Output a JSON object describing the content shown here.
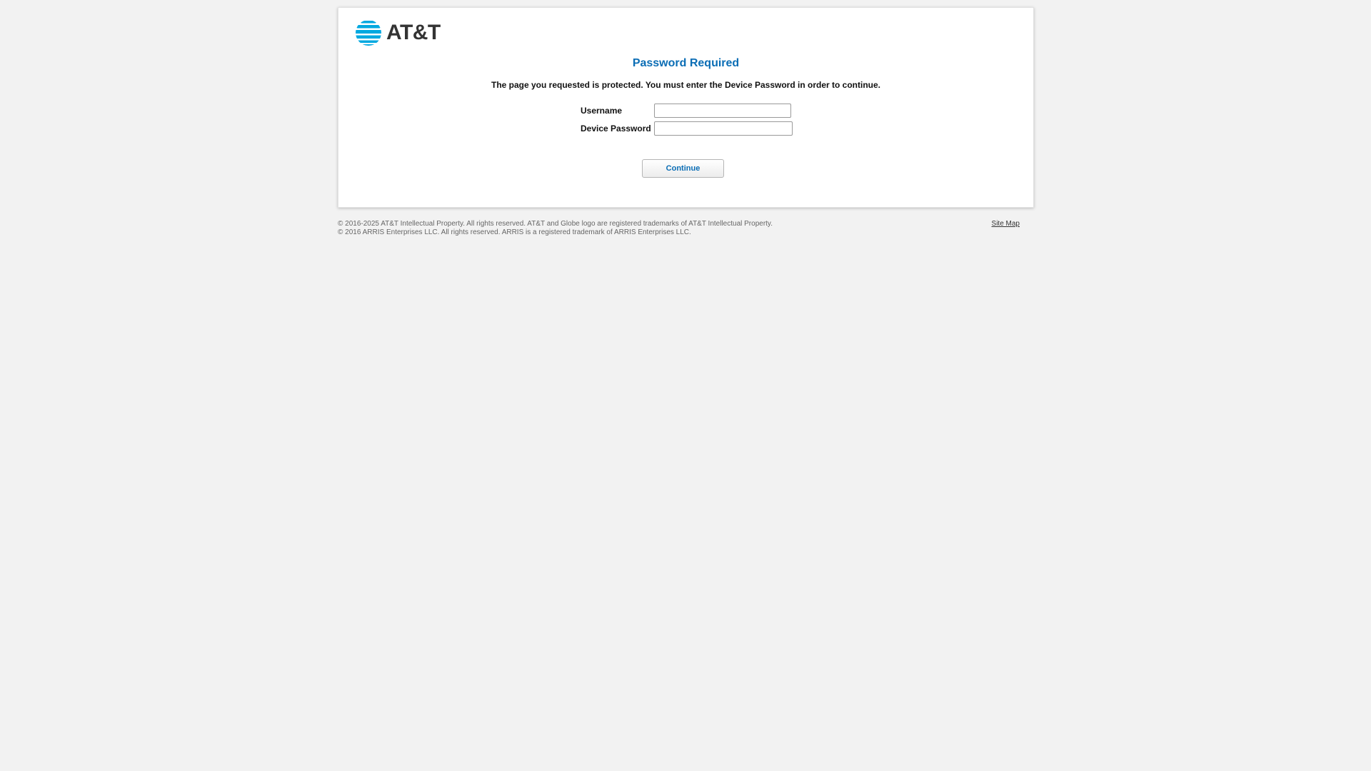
{
  "brand": {
    "logo_text": "AT&T",
    "accent_color": "#0a6db5",
    "globe_color": "#00a8e0",
    "logo_icon": "att-globe-icon"
  },
  "main": {
    "title": "Password Required",
    "description": "The page you requested is protected. You must enter the Device Password in order to continue."
  },
  "form": {
    "username_label": "Username",
    "username_value": "",
    "password_label": "Device Password",
    "password_value": "",
    "continue_label": "Continue"
  },
  "footer": {
    "line1": "© 2016-2025 AT&T Intellectual Property. All rights reserved. AT&T and Globe logo are registered trademarks of AT&T Intellectual Property.",
    "line2": "© 2016 ARRIS Enterprises LLC. All rights reserved. ARRIS is a registered trademark of ARRIS Enterprises LLC.",
    "site_map_label": "Site Map"
  }
}
